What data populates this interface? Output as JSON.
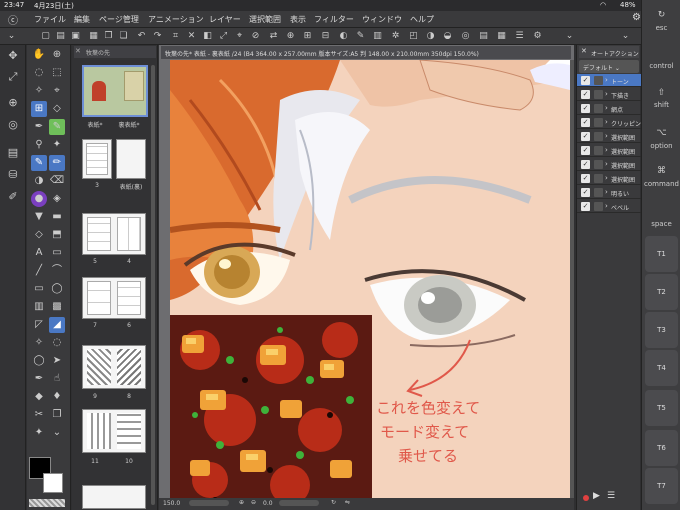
{
  "status": {
    "time": "23:47",
    "date": "4月23日(土)",
    "battery": "48%"
  },
  "menu": [
    "ファイル",
    "編集",
    "ページ管理",
    "アニメーション",
    "レイヤー",
    "選択範囲",
    "表示",
    "フィルター",
    "ウィンドウ",
    "ヘルプ"
  ],
  "page_panel": {
    "tab": "牧葉の先",
    "pages": [
      {
        "label": "表紙*"
      },
      {
        "label": "裏表紙*"
      },
      {
        "label": "3"
      },
      {
        "label": "表紙(裏)"
      },
      {
        "label": "5"
      },
      {
        "label": "4"
      },
      {
        "label": "7"
      },
      {
        "label": "6"
      },
      {
        "label": "9"
      },
      {
        "label": "8"
      },
      {
        "label": "11"
      },
      {
        "label": "10"
      }
    ]
  },
  "canvas": {
    "tab_title": "牧葉の先* 表紙 - 裏表紙 /24 (B4 364.00 x 257.00mm 版本サイズ:A5 判 148.00 x 210.00mm 350dpi 150.0%)",
    "handwriting": [
      "これを色変えて",
      "モード変えて",
      "乗せてる"
    ],
    "zoom": "150.0",
    "rotation": "0.0"
  },
  "layer_panel": {
    "tab": "オートアクション",
    "set": "デフォルト",
    "rows": [
      "トーン",
      "下描き",
      "網点",
      "クリッピング",
      "選択範囲",
      "選択範囲",
      "選択範囲",
      "選択範囲",
      "明るい",
      "ベベル"
    ]
  },
  "keys": {
    "esc": "esc",
    "control": "control",
    "shift": "shift",
    "option": "option",
    "command": "command",
    "space": "space",
    "t": [
      "T1",
      "T2",
      "T3",
      "T4",
      "T5",
      "T6",
      "T7"
    ]
  },
  "colors": {
    "accent": "#4a78c4",
    "hair_orange": "#d96a2e",
    "hair_silver": "#e8e8ee",
    "annotation": "#e0584a"
  }
}
